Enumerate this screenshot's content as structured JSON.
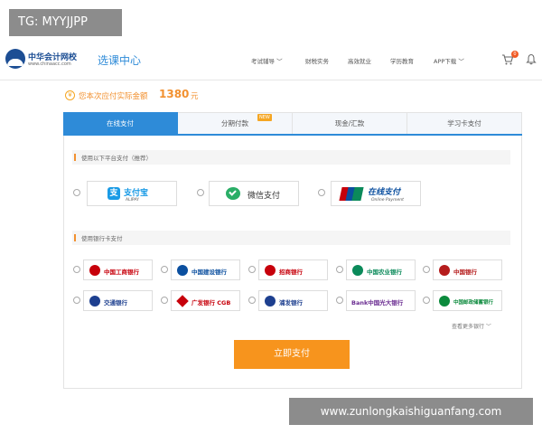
{
  "watermark_top": "TG: MYYJJPP",
  "watermark_bottom": "www.zunlongkaishiguanfang.com",
  "header": {
    "logo_name": "中华会计网校",
    "logo_url": "www.chinaacc.com",
    "section_title": "选课中心",
    "nav": [
      "考试辅导 ﹀",
      "财税实务",
      "高效就业",
      "学历教育",
      "APP下载 ﹀"
    ],
    "cart_count": "0",
    "icons": [
      "cart-icon",
      "bell-icon"
    ]
  },
  "amount": {
    "label": "您本次应付实际金额",
    "value": "1380",
    "unit": "元"
  },
  "tabs": [
    {
      "label": "在线支付",
      "active": true
    },
    {
      "label": "分期付款",
      "badge": "NEW"
    },
    {
      "label": "现金/汇款"
    },
    {
      "label": "学习卡支付"
    }
  ],
  "platform_section": {
    "title": "使用以下平台支付（推荐）",
    "options": [
      {
        "name": "支付宝",
        "sub": "ALIPAY",
        "icon": "alipay-icon",
        "color": "#1a9be6"
      },
      {
        "name": "微信支付",
        "icon": "wechat-icon",
        "color": "#2aae67"
      },
      {
        "name": "在线支付",
        "sub": "Online Payment",
        "icon": "unionpay-icon",
        "color": "#0b4f9f"
      }
    ]
  },
  "bank_section": {
    "title": "使用银行卡支付",
    "banks": [
      {
        "name": "中国工商银行",
        "color": "#c7000b"
      },
      {
        "name": "中国建设银行",
        "color": "#0b4f9f"
      },
      {
        "name": "招商银行",
        "color": "#c7000b"
      },
      {
        "name": "中国农业银行",
        "color": "#0b8a5a"
      },
      {
        "name": "中国银行",
        "color": "#b51c1c"
      },
      {
        "name": "交通银行",
        "color": "#1d3f8f"
      },
      {
        "name": "广发银行 CGB",
        "color": "#c7000b"
      },
      {
        "name": "浦发银行",
        "color": "#1d3f8f"
      },
      {
        "name": "Bank中国光大银行",
        "color": "#6a2c91"
      },
      {
        "name": "中国邮政储蓄银行",
        "color": "#0b8a3c"
      }
    ],
    "more_label": "查看更多银行 ﹀"
  },
  "pay_button": "立即支付"
}
